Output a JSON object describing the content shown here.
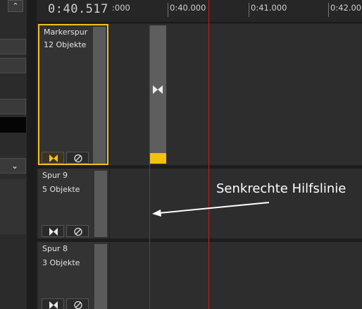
{
  "timeline": {
    "current_time": "0:40.517",
    "ruler_labels": [
      ":000",
      "0:40.000",
      "0:41.000",
      "0:42.000"
    ]
  },
  "tracks": [
    {
      "name": "Markerspur",
      "count": "12 Objekte",
      "selected": true
    },
    {
      "name": "Spur 9",
      "count": "5 Objekte",
      "selected": false
    },
    {
      "name": "Spur 8",
      "count": "3 Objekte",
      "selected": false
    }
  ],
  "annotation": {
    "text": "Senkrechte Hilfslinie"
  },
  "icons": {
    "inspector_top": "chevron-up-down-icon",
    "inspector_dropdown": "chevron-down-icon",
    "marker_object": "bowtie-marker-icon",
    "track_marker_button": "bowtie-marker-icon",
    "track_disable_button": "disable-circle-icon"
  },
  "colors": {
    "selection": "#f0c020",
    "marker_foot": "#f4c20d",
    "playhead": "#d01818",
    "annotation": "#ffffff"
  }
}
